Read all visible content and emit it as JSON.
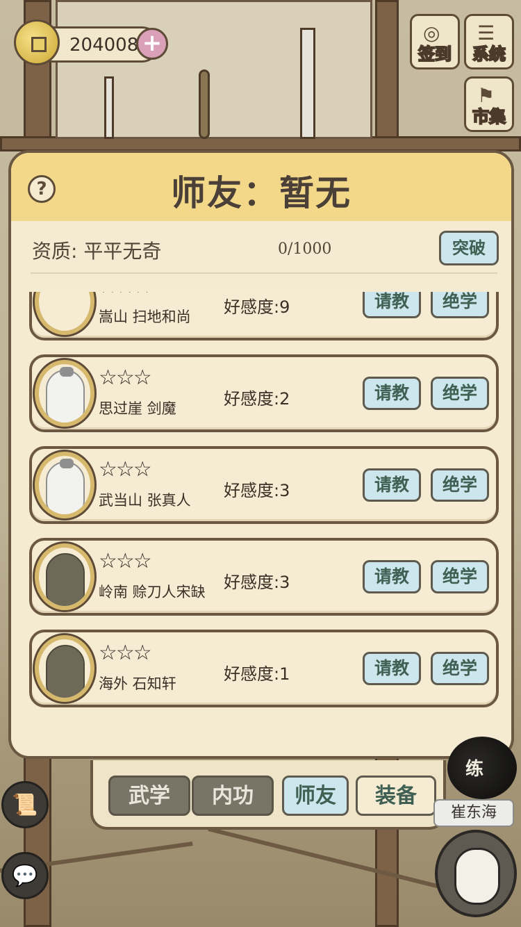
{
  "hud": {
    "coins": "204008",
    "plus": "+",
    "checkin_label": "签到",
    "system_label": "系统",
    "market_label": "市集"
  },
  "dialog": {
    "help": "?",
    "title": "师友：暂无",
    "aptitude": "资质: 平平无奇",
    "progress": "0/1000",
    "breakthrough": "突破"
  },
  "masters": [
    {
      "stars": "☆☆☆",
      "name": "嵩山 扫地和尚",
      "affection": "好感度:9",
      "ask": "请教",
      "skill": "绝学"
    },
    {
      "stars": "☆☆☆",
      "name": "思过崖 剑魔",
      "affection": "好感度:2",
      "ask": "请教",
      "skill": "绝学"
    },
    {
      "stars": "☆☆☆",
      "name": "武当山 张真人",
      "affection": "好感度:3",
      "ask": "请教",
      "skill": "绝学"
    },
    {
      "stars": "☆☆☆",
      "name": "岭南 赊刀人宋缺",
      "affection": "好感度:3",
      "ask": "请教",
      "skill": "绝学"
    },
    {
      "stars": "☆☆☆",
      "name": "海外 石知轩",
      "affection": "好感度:1",
      "ask": "请教",
      "skill": "绝学"
    }
  ],
  "tabs": {
    "martial": "武学",
    "internal": "内功",
    "mentor": "师友",
    "equipment": "装备"
  },
  "npc": {
    "ink_text": "练",
    "name": "崔东海"
  },
  "icons": {
    "chat": "💬",
    "scroll": "📜"
  },
  "colors": {
    "dialog_bg": "#f5ebd3",
    "header_bg": "#f3d88a",
    "button_bg": "#cde6ee",
    "border": "#6b5843"
  }
}
